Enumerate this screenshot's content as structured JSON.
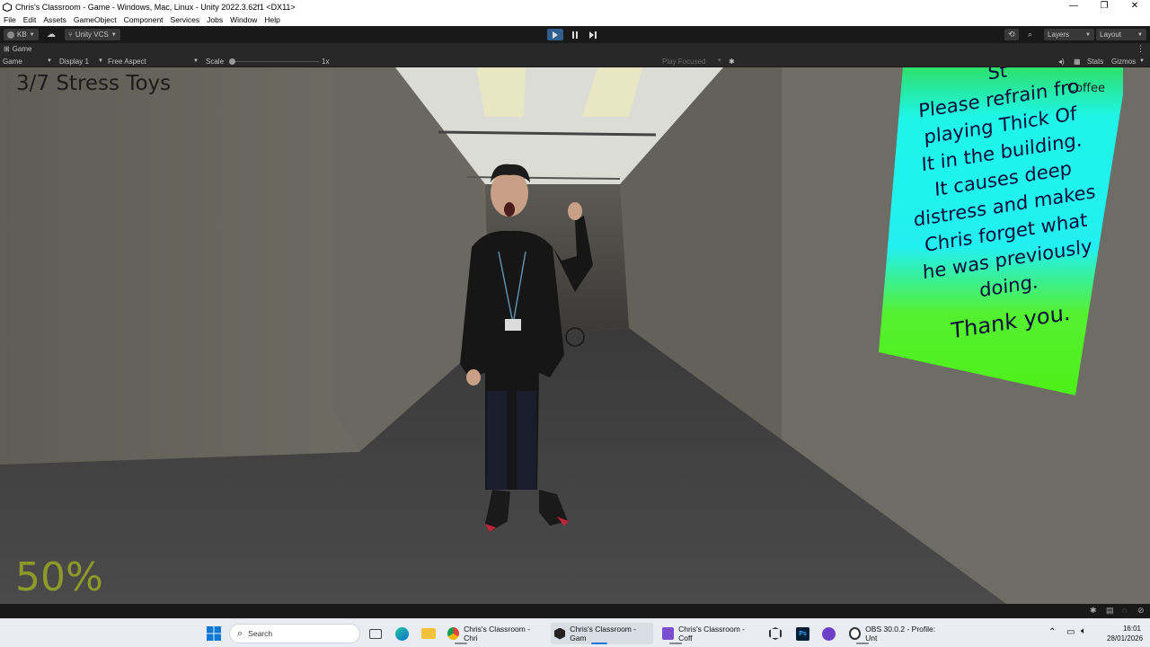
{
  "window": {
    "title": "Chris's Classroom - Game - Windows, Mac, Linux - Unity 2022.3.62f1 <DX11>",
    "controls": [
      "—",
      "❐",
      "✕"
    ]
  },
  "menu": [
    "File",
    "Edit",
    "Assets",
    "GameObject",
    "Component",
    "Services",
    "Jobs",
    "Window",
    "Help"
  ],
  "toolbar": {
    "account": "KB",
    "vcs": "Unity VCS",
    "layers": "Layers",
    "layout": "Layout"
  },
  "tab": {
    "label": "Game"
  },
  "gamebar": {
    "mode": "Game",
    "display": "Display 1",
    "aspect": "Free Aspect",
    "scale_label": "Scale",
    "scale_value": "1x",
    "play_focused": "Play Focused",
    "stats": "Stats",
    "gizmos": "Gizmos"
  },
  "game": {
    "counter": "3/7 Stress Toys",
    "percent": "50%",
    "coffee_label": "Coffee",
    "sign": {
      "top": "St",
      "lines": [
        "Please refrain fro",
        "playing Thick Of",
        "It in the building.",
        "It causes deep",
        "distress and makes",
        "Chris forget what",
        "he was previously",
        "doing.",
        "Thank you."
      ]
    }
  },
  "taskbar": {
    "search_placeholder": "Search",
    "apps": [
      {
        "label": "Chris's Classroom - Chri",
        "icon": "chrome-icon"
      },
      {
        "label": "Chris's Classroom - Gam",
        "icon": "unity-icon"
      },
      {
        "label": "Chris's Classroom - Coff",
        "icon": "visual-studio-icon"
      },
      {
        "label": "OBS 30.0.2 - Profile: Unt",
        "icon": "obs-icon"
      }
    ],
    "time": "16:01",
    "date": "28/01/2026"
  }
}
